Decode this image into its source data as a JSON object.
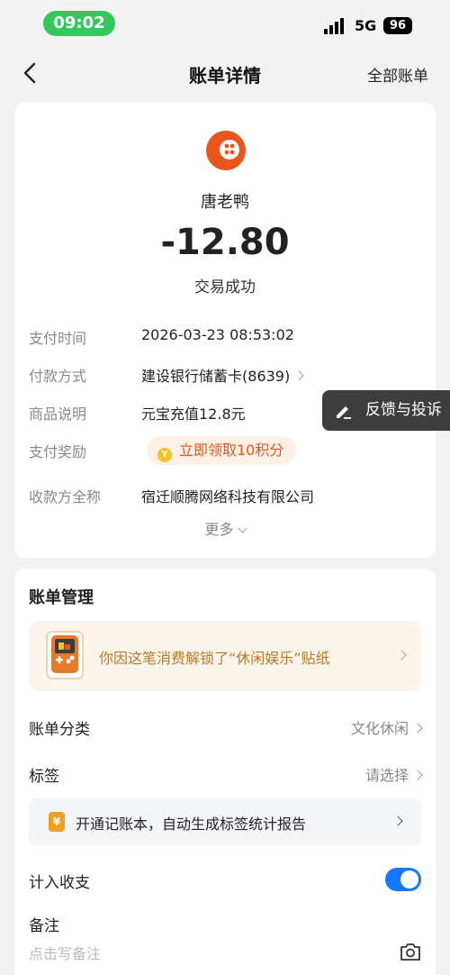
{
  "status_bar": {
    "time": "09:02",
    "network": "5G",
    "battery": "96"
  },
  "nav": {
    "title": "账单详情",
    "right_link": "全部账单"
  },
  "summary": {
    "merchant": "唐老鸭",
    "amount": "-12.80",
    "status": "交易成功"
  },
  "details": [
    {
      "label": "支付时间",
      "value": "2026-03-23 08:53:02"
    },
    {
      "label": "付款方式",
      "value": "建设银行储蓄卡(8639)"
    },
    {
      "label": "商品说明",
      "value": "元宝充值12.8元"
    },
    {
      "label": "支付奖励",
      "value": "立即领取10积分"
    },
    {
      "label": "收款方全称",
      "value": "宿迁顺腾网络科技有限公司"
    }
  ],
  "more_label": "更多",
  "feedback_label": "反馈与投诉",
  "management": {
    "title": "账单管理",
    "sticker_text": "你因这笔消费解锁了“休闲娱乐”贴纸",
    "category_label": "账单分类",
    "category_value": "文化休闲",
    "tag_label": "标签",
    "tag_value": "请选择",
    "promo_text": "开通记账本，自动生成标签统计报告",
    "income_label": "计入收支",
    "income_enabled": true,
    "note_label": "备注",
    "note_placeholder": "点击写备注"
  },
  "colors": {
    "accent": "#1677ff",
    "logo": "#e8551d",
    "status_pill": "#34c759"
  }
}
